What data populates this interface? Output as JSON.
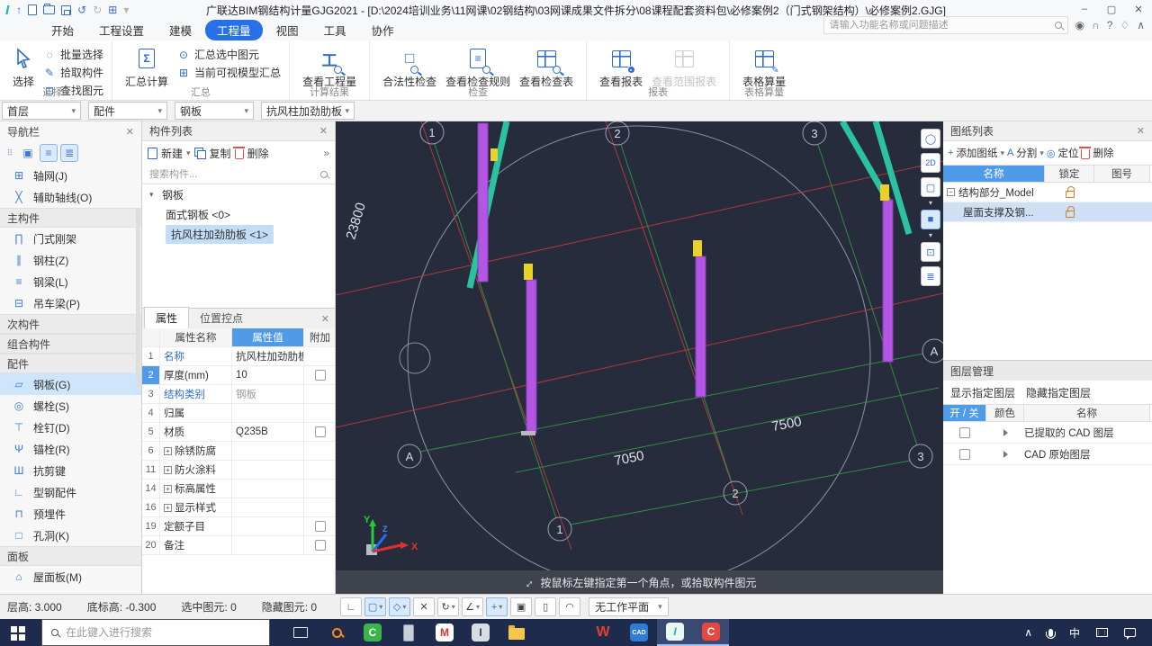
{
  "titlebar": {
    "title": "广联达BIM钢结构计量GJG2021 - [D:\\2024培训业务\\11网课\\02钢结构\\03网课成果文件拆分\\08课程配套资料包\\必修案例2（门式钢架结构）\\必修案例2.GJG]"
  },
  "colors": {
    "accent": "#2670e8",
    "prop_value_header": "#4f9be8",
    "viewport_bg": "#262c3b",
    "column_magenta": "#b356e3",
    "brace_teal": "#2bc2a0",
    "marker_yellow": "#e8d22a",
    "grid_green": "#2f8f3c",
    "cad_line_red": "#b03a3a",
    "selection_blue": "#cfe5fb",
    "taskbar_bg": "#1f2b4d"
  },
  "icons": {
    "app_logo": "I",
    "upload": "↑",
    "undo": "↺",
    "redo": "↻",
    "grid": "⊞",
    "more": "▾",
    "chev": "▾",
    "close": "✕",
    "min": "–",
    "max": "▢",
    "user": "◉",
    "service": "∩",
    "help": "?",
    "theme": "♢",
    "collapse": "∧",
    "batch_select": "◌",
    "pick_member": "✎",
    "find_element": "⊡",
    "sigma": "Σ",
    "sum_selected": "⊙",
    "sum_visible": "⊞",
    "quantity": "工",
    "legality": "□",
    "nav_move": "⠿",
    "nav_thumb": "▣",
    "nav_list": "≡",
    "nav_card": "≣",
    "tree_arrow": "▾",
    "more2": "»",
    "expand_plus": "+",
    "minus": "−",
    "add_plus": "+",
    "split_a": "A",
    "locate": "◎",
    "orbit": "◯",
    "two_d": "2D",
    "cube_wire": "▢",
    "cube_solid": "■",
    "extents": "⊡",
    "view_list": "≣",
    "st_angle": "∟",
    "st_rect": "▢",
    "st_cube": "◇",
    "st_x": "✕",
    "st_rotate": "↻",
    "st_angle2": "∠",
    "st_snap": "+",
    "st_img": "▣",
    "st_bldg": "▯",
    "st_arc": "◠",
    "prompt_arrows": "↔",
    "wps": "W",
    "cad": "CAD",
    "gjg": "I",
    "camtasia": "C",
    "green_c": "C",
    "red_m": "M",
    "steel_i": "I"
  },
  "tabs": [
    {
      "label": "开始"
    },
    {
      "label": "工程设置"
    },
    {
      "label": "建模"
    },
    {
      "label": "工程量",
      "active": true
    },
    {
      "label": "视图"
    },
    {
      "label": "工具"
    },
    {
      "label": "协作"
    }
  ],
  "help": {
    "search_placeholder": "请输入功能名称或问题描述"
  },
  "ribbon": {
    "select_group": {
      "label": "选择",
      "big": "选择",
      "items": [
        "批量选择",
        "拾取构件",
        "查找图元"
      ]
    },
    "summary_group": {
      "label": "汇总",
      "big": "汇总计算",
      "items": [
        "汇总选中图元",
        "当前可视模型汇总"
      ]
    },
    "result_group": {
      "label": "计算结果",
      "big": "查看工程量"
    },
    "check_group": {
      "label": "检查",
      "items": [
        "合法性检查",
        "查看检查规则",
        "查看检查表"
      ]
    },
    "report_group": {
      "label": "报表",
      "items": [
        "查看报表",
        "查看范围报表"
      ]
    },
    "table_group": {
      "label": "表格算量",
      "big": "表格算量"
    }
  },
  "contextbar": {
    "selects": [
      "首层",
      "配件",
      "钢板",
      "抗风柱加劲肋板"
    ]
  },
  "nav": {
    "title": "导航栏",
    "items": [
      {
        "type": "item",
        "glyph": "⊞",
        "label": "轴网(J)"
      },
      {
        "type": "item",
        "glyph": "╳",
        "label": "辅助轴线(O)"
      },
      {
        "type": "section",
        "label": "主构件"
      },
      {
        "type": "item",
        "glyph": "∏",
        "label": "门式刚架"
      },
      {
        "type": "item",
        "glyph": "∥",
        "label": "钢柱(Z)"
      },
      {
        "type": "item",
        "glyph": "≡",
        "label": "钢梁(L)"
      },
      {
        "type": "item",
        "glyph": "⊟",
        "label": "吊车梁(P)"
      },
      {
        "type": "section",
        "label": "次构件"
      },
      {
        "type": "section",
        "label": "组合构件"
      },
      {
        "type": "section",
        "label": "配件"
      },
      {
        "type": "item",
        "glyph": "▱",
        "label": "钢板(G)",
        "selected": true
      },
      {
        "type": "item",
        "glyph": "◎",
        "label": "螺栓(S)"
      },
      {
        "type": "item",
        "glyph": "⊤",
        "label": "栓钉(D)"
      },
      {
        "type": "item",
        "glyph": "Ψ",
        "label": "锚栓(R)"
      },
      {
        "type": "item",
        "glyph": "Ш",
        "label": "抗剪键"
      },
      {
        "type": "item",
        "glyph": "∟",
        "label": "型钢配件"
      },
      {
        "type": "item",
        "glyph": "⊓",
        "label": "预埋件"
      },
      {
        "type": "item",
        "glyph": "□",
        "label": "孔洞(K)"
      },
      {
        "type": "section",
        "label": "面板"
      },
      {
        "type": "item",
        "glyph": "⌂",
        "label": "屋面板(M)"
      }
    ]
  },
  "components": {
    "title": "构件列表",
    "new_btn": "新建",
    "copy_btn": "复制",
    "delete_btn": "删除",
    "search_placeholder": "搜索构件...",
    "group": "钢板",
    "items": [
      {
        "label": "面式钢板 <0>"
      },
      {
        "label": "抗风柱加劲肋板 <1>",
        "selected": true
      }
    ]
  },
  "properties": {
    "tab_props": "属性",
    "tab_position": "位置控点",
    "col_name": "属性名称",
    "col_value": "属性值",
    "col_attach": "附加",
    "rows": [
      {
        "num": "1",
        "name": "名称",
        "value": "抗风柱加劲肋板"
      },
      {
        "num": "2",
        "name": "厚度(mm)",
        "value": "10"
      },
      {
        "num": "3",
        "name": "结构类别",
        "value": "钢板"
      },
      {
        "num": "4",
        "name": "归属",
        "value": ""
      },
      {
        "num": "5",
        "name": "材质",
        "value": "Q235B"
      },
      {
        "num": "6",
        "name": "除锈防腐",
        "value": ""
      },
      {
        "num": "11",
        "name": "防火涂料",
        "value": ""
      },
      {
        "num": "14",
        "name": "标高属性",
        "value": ""
      },
      {
        "num": "16",
        "name": "显示样式",
        "value": ""
      },
      {
        "num": "19",
        "name": "定额子目",
        "value": ""
      },
      {
        "num": "20",
        "name": "备注",
        "value": ""
      }
    ]
  },
  "viewport": {
    "prompt": "按鼠标左键指定第一个角点，或拾取构件图元",
    "dim_23800": "23800",
    "dim_7050": "7050",
    "dim_7500": "7500",
    "bubble_top_1": "1",
    "bubble_top_2": "2",
    "bubble_top_3": "3",
    "bubble_a_left": "A",
    "bubble_a_right": "A",
    "bubble_bot_1": "1",
    "bubble_bot_2": "2",
    "bubble_bot_3": "3",
    "axis_x": "X",
    "axis_y": "Y",
    "axis_z": "Z"
  },
  "sheets": {
    "title": "图纸列表",
    "add_btn": "添加图纸",
    "split_btn": "分割",
    "locate_btn": "定位",
    "delete_btn": "删除",
    "col_name": "名称",
    "col_lock": "锁定",
    "col_no": "图号",
    "rows": [
      {
        "name": "结构部分_Model"
      },
      {
        "name": "屋面支撑及钢...",
        "selected": true
      }
    ]
  },
  "layers": {
    "title": "图层管理",
    "show_btn": "显示指定图层",
    "hide_btn": "隐藏指定图层",
    "col_onoff": "开 / 关",
    "col_color": "颜色",
    "col_name": "名称",
    "rows": [
      {
        "name": "已提取的 CAD 图层"
      },
      {
        "name": "CAD 原始图层"
      }
    ]
  },
  "statusbar": {
    "floor_height": "层高: 3.000",
    "base_elev": "底标高: -0.300",
    "selected": "选中图元: 0",
    "hidden": "隐藏图元: 0",
    "workplane": "无工作平面"
  },
  "taskbar": {
    "search_placeholder": "在此键入进行搜索",
    "ime": "中"
  }
}
